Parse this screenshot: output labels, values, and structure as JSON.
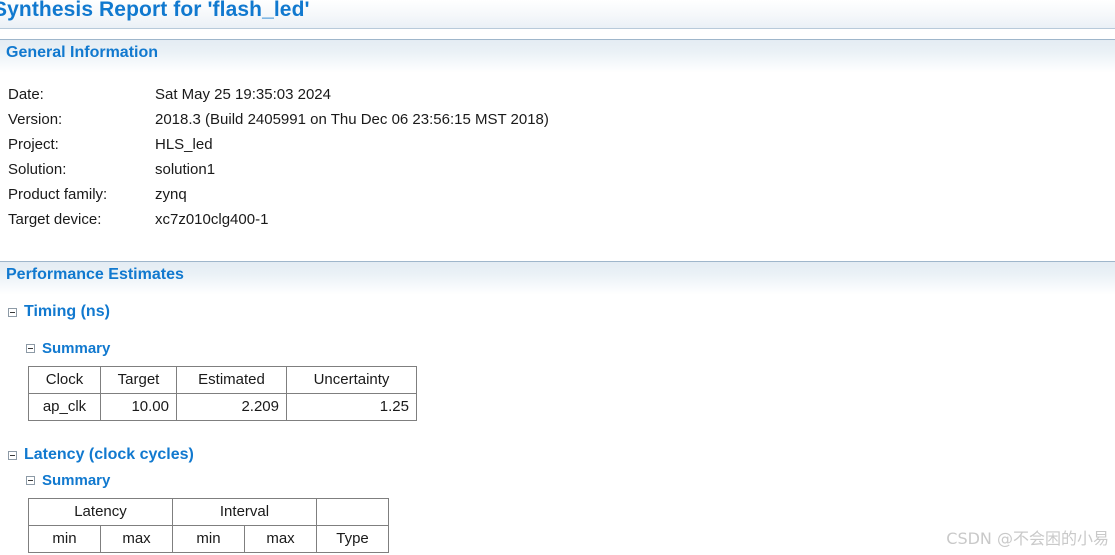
{
  "report": {
    "title": "Synthesis Report for 'flash_led'",
    "title_clipped_left": true
  },
  "sections": {
    "general_information": {
      "heading": "General Information",
      "rows": [
        {
          "label": "Date:",
          "value": "Sat May 25 19:35:03 2024"
        },
        {
          "label": "Version:",
          "value": "2018.3 (Build 2405991 on Thu Dec 06 23:56:15 MST 2018)"
        },
        {
          "label": "Project:",
          "value": "HLS_led"
        },
        {
          "label": "Solution:",
          "value": "solution1"
        },
        {
          "label": "Product family:",
          "value": "zynq"
        },
        {
          "label": "Target device:",
          "value": "xc7z010clg400-1"
        }
      ]
    },
    "performance_estimates": {
      "heading": "Performance Estimates",
      "timing": {
        "label": "Timing (ns)",
        "collapse_icon": "minus-box-icon",
        "summary": {
          "label": "Summary",
          "collapse_icon": "minus-box-icon",
          "columns": [
            "Clock",
            "Target",
            "Estimated",
            "Uncertainty"
          ],
          "rows": [
            [
              "ap_clk",
              "10.00",
              "2.209",
              "1.25"
            ]
          ]
        }
      },
      "latency": {
        "label": "Latency (clock cycles)",
        "collapse_icon": "minus-box-icon",
        "summary": {
          "label": "Summary",
          "collapse_icon": "minus-box-icon",
          "group_headers": [
            "Latency",
            "Interval",
            ""
          ],
          "sub_headers": [
            "min",
            "max",
            "min",
            "max",
            "Type"
          ],
          "rows": []
        }
      }
    }
  },
  "watermark": {
    "text": "CSDN @不会困的小易"
  },
  "colors": {
    "heading_blue": "#1179cf",
    "band_border": "#9fb6cb",
    "table_border": "#7f7f7f",
    "body_text": "#1a1a1a",
    "watermark": "#c9c9c9"
  }
}
